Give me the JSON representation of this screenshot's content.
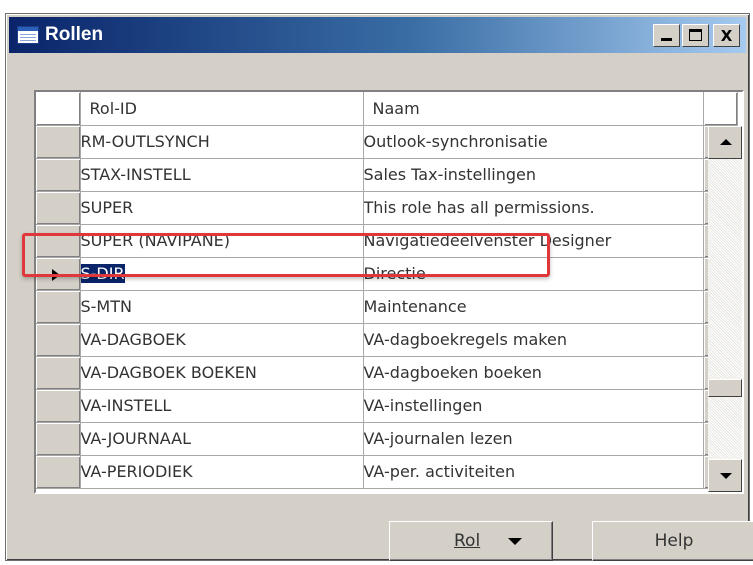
{
  "window": {
    "title": "Rollen",
    "buttons": [
      "minimize",
      "maximize",
      "close"
    ],
    "close_label": "X"
  },
  "grid": {
    "columns": [
      "Rol-ID",
      "Naam"
    ],
    "rows": [
      {
        "id": "RM-OUTLSYNCH",
        "name": "Outlook-synchronisatie"
      },
      {
        "id": "STAX-INSTELL",
        "name": "Sales Tax-instellingen"
      },
      {
        "id": "SUPER",
        "name": "This role has all permissions."
      },
      {
        "id": "SUPER (NAVIPANE)",
        "name": "Navigatiedeelvenster Designer"
      },
      {
        "id": "S-DIR",
        "name": "Directie",
        "selected": true
      },
      {
        "id": "S-MTN",
        "name": "Maintenance"
      },
      {
        "id": "VA-DAGBOEK",
        "name": "VA-dagboekregels maken"
      },
      {
        "id": "VA-DAGBOEK BOEKEN",
        "name": "VA-dagboeken boeken"
      },
      {
        "id": "VA-INSTELL",
        "name": "VA-instellingen"
      },
      {
        "id": "VA-JOURNAAL",
        "name": "VA-journalen lezen"
      },
      {
        "id": "VA-PERIODIEK",
        "name": "VA-per. activiteiten"
      }
    ]
  },
  "footer": {
    "rol_button": "Rol",
    "help_button": "Help"
  },
  "colors": {
    "titlebar_start": "#0a246a",
    "titlebar_end": "#a6caf0",
    "selection": "#0a246a",
    "highlight": "#e0383a",
    "window_bg": "#d4d0c8"
  }
}
